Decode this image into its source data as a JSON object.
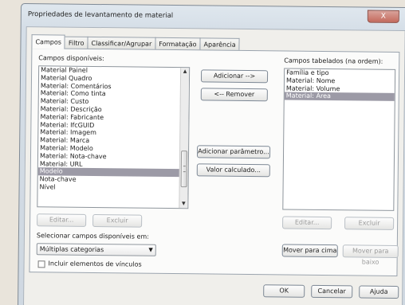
{
  "dialog": {
    "title": "Propriedades de levantamento de material",
    "close_glyph": "X"
  },
  "tabs": [
    {
      "label": "Campos"
    },
    {
      "label": "Filtro"
    },
    {
      "label": "Classificar/Agrupar"
    },
    {
      "label": "Formatação"
    },
    {
      "label": "Aparência"
    }
  ],
  "available": {
    "label": "Campos disponíveis:",
    "items": [
      "Material Painel",
      "Material Quadro",
      "Material: Comentários",
      "Material: Como tinta",
      "Material: Custo",
      "Material: Descrição",
      "Material: Fabricante",
      "Material: IfcGUID",
      "Material: Imagem",
      "Material: Marca",
      "Material: Modelo",
      "Material: Nota-chave",
      "Material: URL",
      "Modelo",
      "Nota-chave",
      "Nível"
    ],
    "selected_item": "Modelo",
    "edit_label": "Editar...",
    "delete_label": "Excluir"
  },
  "scheduled": {
    "label": "Campos tabelados (na ordem):",
    "items": [
      "Família e tipo",
      "Material: Nome",
      "Material: Volume",
      "Material: Área"
    ],
    "selected_item": "Material: Área",
    "edit_label": "Editar...",
    "delete_label": "Excluir",
    "move_up_label": "Mover para cima",
    "move_down_label": "Mover para baixo"
  },
  "middle_buttons": {
    "add": "Adicionar -->",
    "remove": "<-- Remover",
    "add_parameter": "Adicionar parâmetro...",
    "calculated_value": "Valor calculado..."
  },
  "select_from": {
    "label": "Selecionar campos disponíveis em:",
    "value": "Múltiplas categorias"
  },
  "include_links": {
    "label": "Incluir elementos de vínculos",
    "checked": false
  },
  "footer": {
    "ok": "OK",
    "cancel": "Cancelar",
    "help": "Ajuda"
  },
  "icons": [
    "close-icon",
    "chevron-up-icon",
    "chevron-down-icon",
    "dropdown-arrow-icon"
  ]
}
